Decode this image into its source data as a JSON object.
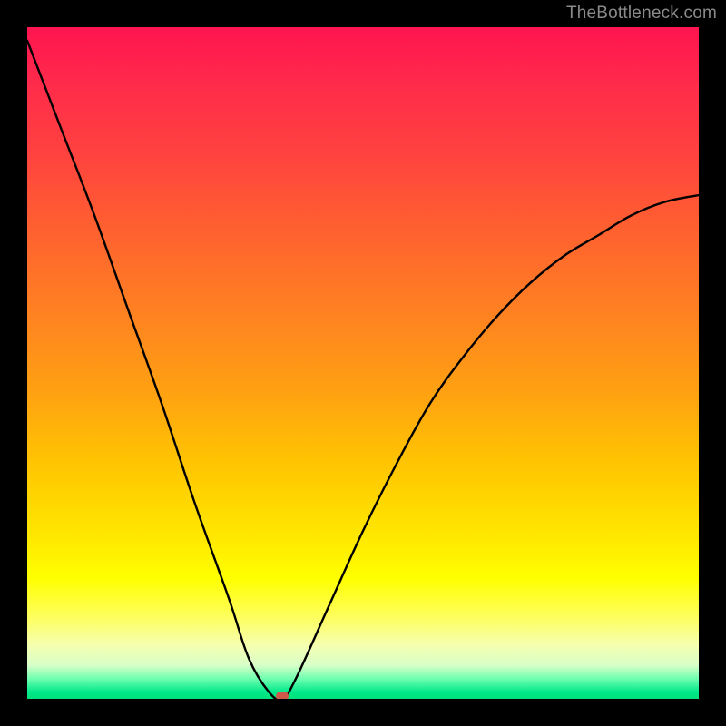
{
  "attribution": "TheBottleneck.com",
  "colors": {
    "background": "#000000",
    "curve": "#000000",
    "marker": "#cf5a4a",
    "gradient_top": "#ff1450",
    "gradient_bottom": "#00e07a"
  },
  "chart_data": {
    "type": "line",
    "title": "",
    "xlabel": "",
    "ylabel": "",
    "xlim": [
      0,
      100
    ],
    "ylim": [
      0,
      100
    ],
    "grid": false,
    "series": [
      {
        "name": "bottleneck-curve",
        "x": [
          0,
          5,
          10,
          15,
          20,
          25,
          30,
          33,
          36,
          38,
          40,
          45,
          50,
          55,
          60,
          65,
          70,
          75,
          80,
          85,
          90,
          95,
          100
        ],
        "values": [
          98,
          85,
          72,
          58,
          44,
          29,
          15,
          6,
          1,
          0,
          3,
          14,
          25,
          35,
          44,
          51,
          57,
          62,
          66,
          69,
          72,
          74,
          75
        ]
      }
    ],
    "annotations": [
      {
        "name": "minimum-marker",
        "x": 38,
        "y": 0
      }
    ]
  }
}
